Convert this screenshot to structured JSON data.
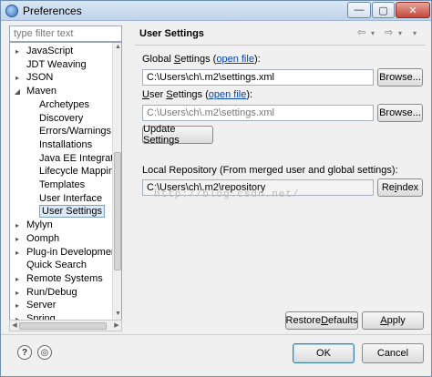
{
  "window": {
    "title": "Preferences"
  },
  "titlebar": {
    "minimize": "—",
    "maximize": "▢",
    "close": "✕"
  },
  "filter": {
    "placeholder": "type filter text"
  },
  "tree": [
    {
      "label": "JavaScript",
      "level": 0,
      "twisty": "▸"
    },
    {
      "label": "JDT Weaving",
      "level": 0,
      "twisty": ""
    },
    {
      "label": "JSON",
      "level": 0,
      "twisty": "▸"
    },
    {
      "label": "Maven",
      "level": 0,
      "twisty": "◢"
    },
    {
      "label": "Archetypes",
      "level": 1,
      "twisty": ""
    },
    {
      "label": "Discovery",
      "level": 1,
      "twisty": ""
    },
    {
      "label": "Errors/Warnings",
      "level": 1,
      "twisty": ""
    },
    {
      "label": "Installations",
      "level": 1,
      "twisty": ""
    },
    {
      "label": "Java EE Integration",
      "level": 1,
      "twisty": ""
    },
    {
      "label": "Lifecycle Mapping",
      "level": 1,
      "twisty": ""
    },
    {
      "label": "Templates",
      "level": 1,
      "twisty": ""
    },
    {
      "label": "User Interface",
      "level": 1,
      "twisty": ""
    },
    {
      "label": "User Settings",
      "level": 1,
      "twisty": "",
      "selected": true
    },
    {
      "label": "Mylyn",
      "level": 0,
      "twisty": "▸"
    },
    {
      "label": "Oomph",
      "level": 0,
      "twisty": "▸"
    },
    {
      "label": "Plug-in Development",
      "level": 0,
      "twisty": "▸"
    },
    {
      "label": "Quick Search",
      "level": 0,
      "twisty": ""
    },
    {
      "label": "Remote Systems",
      "level": 0,
      "twisty": "▸"
    },
    {
      "label": "Run/Debug",
      "level": 0,
      "twisty": "▸"
    },
    {
      "label": "Server",
      "level": 0,
      "twisty": "▸"
    },
    {
      "label": "Spring",
      "level": 0,
      "twisty": "▸"
    }
  ],
  "page": {
    "title": "User Settings",
    "nav_back": "⇦",
    "nav_forward": "⇨",
    "nav_menu": "▾"
  },
  "global": {
    "label_pre": "Global ",
    "label_u": "S",
    "label_post": "ettings (",
    "link": "open file",
    "label_end": "):",
    "value": "C:\\Users\\ch\\.m2\\settings.xml",
    "browse": "Browse..."
  },
  "user": {
    "label_u": "U",
    "label_pre": "ser ",
    "label_u2": "S",
    "label_post": "ettings (",
    "link": "open file",
    "label_end": "):",
    "value": "C:\\Users\\ch\\.m2\\settings.xml",
    "browse": "Browse..."
  },
  "update_button": "Update Settings",
  "local_repo": {
    "label": "Local Repository (From merged user and global settings):",
    "value": "C:\\Users\\ch\\.m2\\repository",
    "reindex_pre": "Re",
    "reindex_u": "i",
    "reindex_post": "ndex"
  },
  "watermark": "http://blog.csdn.net/",
  "buttons": {
    "restore_pre": "Restore ",
    "restore_u": "D",
    "restore_post": "efaults",
    "apply_u": "A",
    "apply_post": "pply",
    "ok": "OK",
    "cancel": "Cancel"
  },
  "icons": {
    "help": "?",
    "import_export": "◎"
  }
}
